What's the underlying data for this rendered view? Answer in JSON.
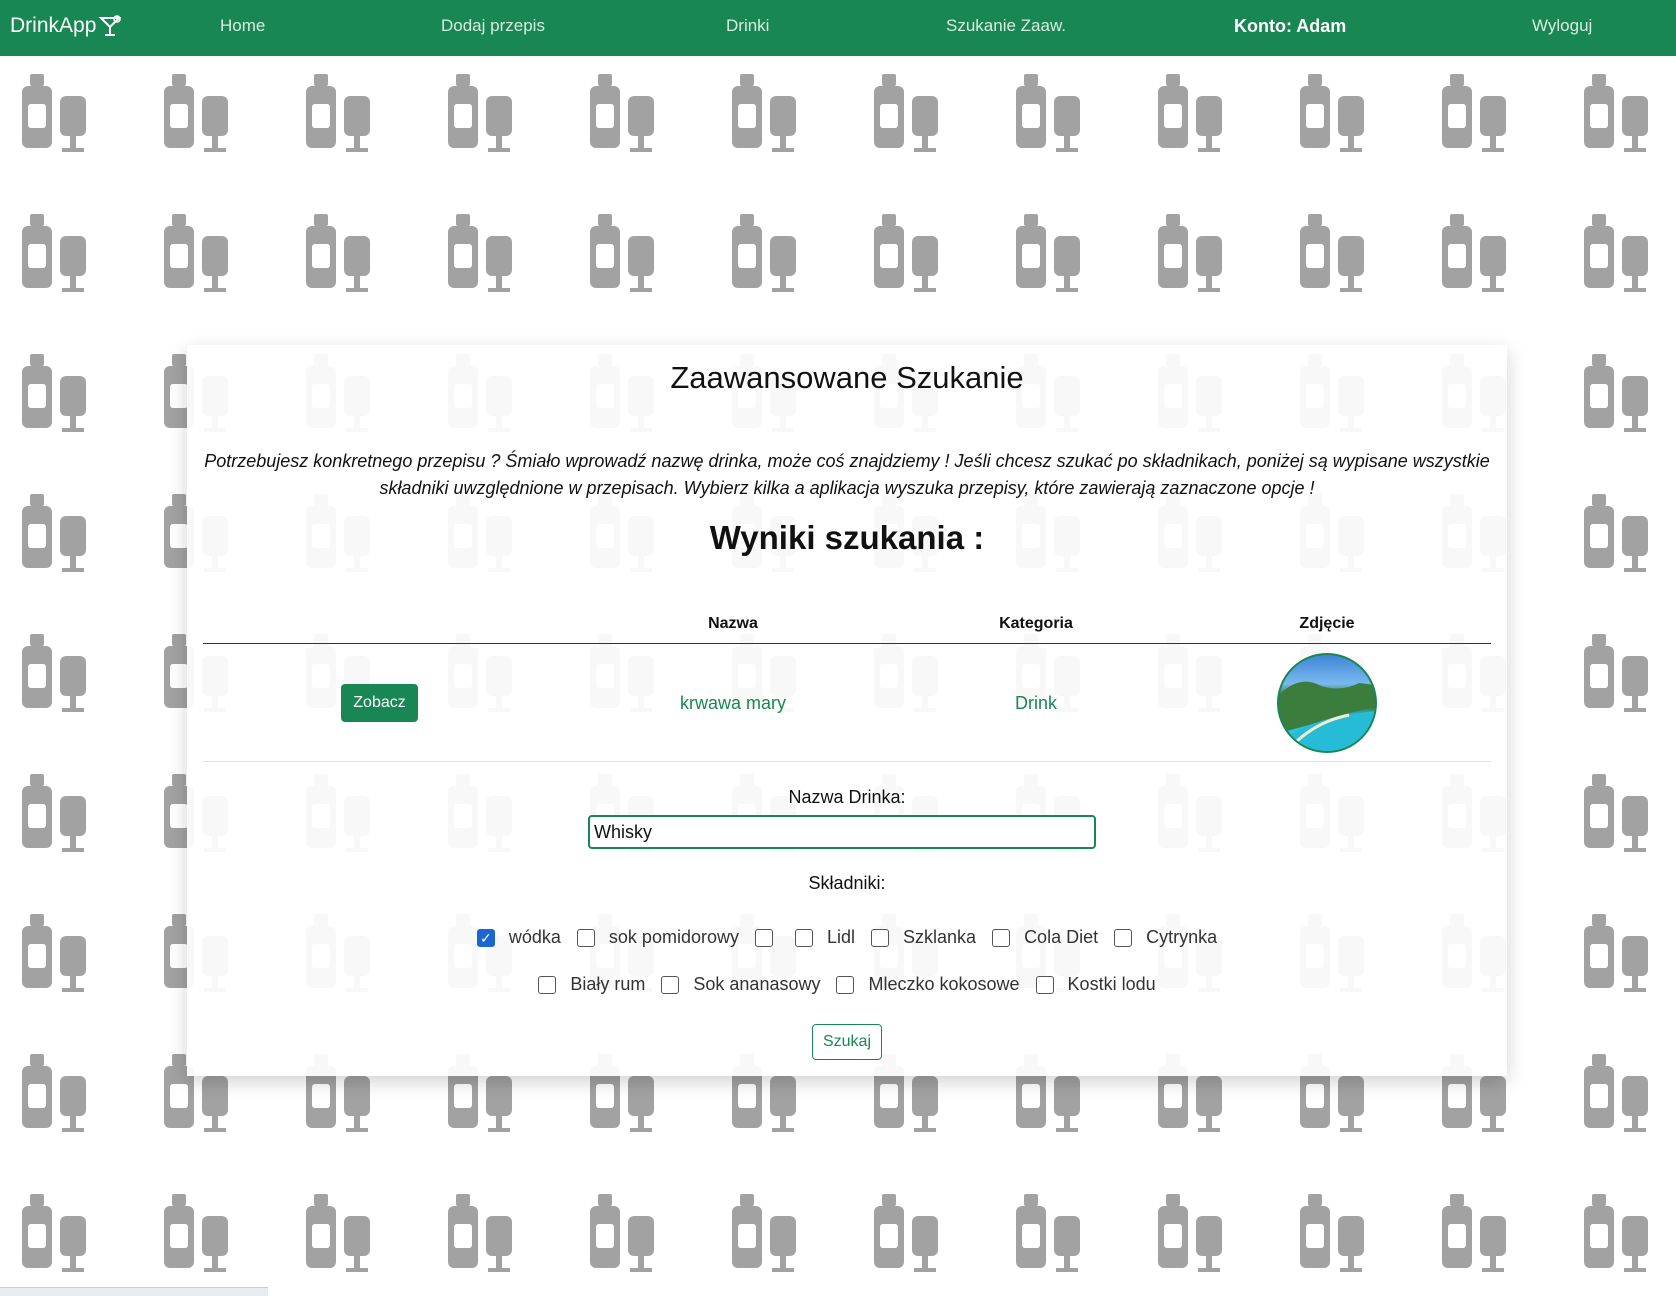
{
  "navbar": {
    "brand": "DrinkApp",
    "links": [
      "Home",
      "Dodaj przepis",
      "Drinki",
      "Szukanie Zaaw.",
      "Konto: Adam",
      "Wyloguj"
    ],
    "active_index": 4
  },
  "card": {
    "title": "Zaawansowane Szukanie",
    "intro": "Potrzebujesz konkretnego przepisu ? Śmiało wprowadź nazwę drinka, może coś znajdziemy ! Jeśli chcesz szukać po składnikach, poniżej są wypisane wszystkie składniki uwzględnione w przepisach. Wybierz kilka a aplikacja wyszuka przepisy, które zawierają zaznaczone opcje !",
    "results_title": "Wyniki szukania :"
  },
  "table": {
    "headers": [
      "",
      "Nazwa",
      "Kategoria",
      "Zdjęcie"
    ],
    "rows": [
      {
        "action": "Zobacz",
        "name": "krwawa mary",
        "category": "Drink"
      }
    ]
  },
  "form": {
    "name_label": "Nazwa Drinka:",
    "name_value": "Whisky",
    "ingredients_label": "Składniki:",
    "ingredients_row1": [
      {
        "label": "wódka",
        "checked": true
      },
      {
        "label": "sok pomidorowy",
        "checked": false
      },
      {
        "label": "",
        "checked": false
      },
      {
        "label": "Lidl",
        "checked": false
      },
      {
        "label": "Szklanka",
        "checked": false
      },
      {
        "label": "Cola Diet",
        "checked": false
      },
      {
        "label": "Cytrynka",
        "checked": false
      }
    ],
    "ingredients_row2": [
      {
        "label": "Biały rum",
        "checked": false
      },
      {
        "label": "Sok ananasowy",
        "checked": false
      },
      {
        "label": "Mleczko kokosowe",
        "checked": false
      },
      {
        "label": "Kostki lodu",
        "checked": false
      }
    ],
    "search_button": "Szukaj"
  },
  "colors": {
    "accent": "#198754",
    "checkbox": "#1a67d2"
  }
}
